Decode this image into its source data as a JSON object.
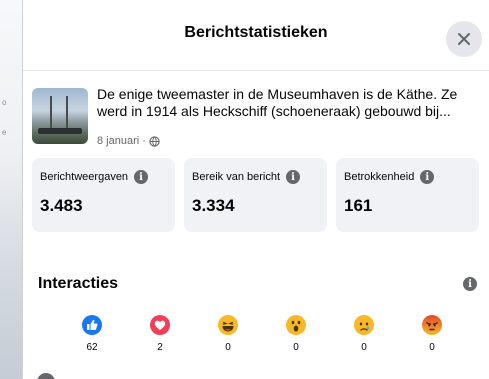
{
  "dialog": {
    "title": "Berichtstatistieken",
    "close_icon": "close-icon"
  },
  "post": {
    "text": "De enige tweemaster in de Museumhaven is de Käthe. Ze werd in 1914 als Heckschiff (schoeneraak) gebouwd bij...",
    "date": "8 januari ·",
    "privacy_icon": "globe-icon"
  },
  "stats": [
    {
      "label": "Berichtweergaven",
      "value": "3.483"
    },
    {
      "label": "Bereik van bericht",
      "value": "3.334"
    },
    {
      "label": "Betrokkenheid",
      "value": "161"
    }
  ],
  "interactions": {
    "title": "Interacties",
    "reactions": [
      {
        "icon": "like-icon",
        "count": "62"
      },
      {
        "icon": "love-icon",
        "count": "2"
      },
      {
        "icon": "haha-icon",
        "count": "0"
      },
      {
        "icon": "wow-icon",
        "count": "0"
      },
      {
        "icon": "sad-icon",
        "count": "0"
      },
      {
        "icon": "angry-icon",
        "count": "0"
      }
    ]
  },
  "colors": {
    "like": "#1877f2",
    "love": "#f33e58",
    "emoji_yellow": "#f7b928",
    "angry": "#e9710f",
    "card_bg": "#f0f2f5",
    "info_gray": "#65676b"
  }
}
